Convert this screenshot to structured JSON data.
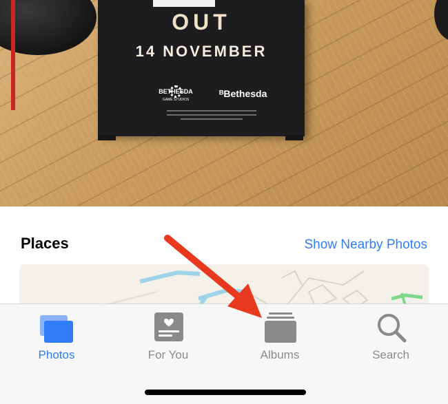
{
  "photo": {
    "sign_headline": "OUT",
    "sign_date": "14 NOVEMBER",
    "logo_studio_line1": "BETHESDA",
    "logo_studio_line2": "GAME STUDIOS",
    "logo_publisher": "ᴮBethesda"
  },
  "places": {
    "title": "Places",
    "link": "Show Nearby Photos"
  },
  "tabbar": {
    "tabs": [
      {
        "label": "Photos",
        "icon": "photos-icon",
        "active": true
      },
      {
        "label": "For You",
        "icon": "for-you-icon",
        "active": false
      },
      {
        "label": "Albums",
        "icon": "albums-icon",
        "active": false
      },
      {
        "label": "Search",
        "icon": "search-icon",
        "active": false
      }
    ]
  },
  "colors": {
    "accent": "#2f7cf6",
    "inactive": "#8a8a8a",
    "annotation_arrow": "#e8391f"
  }
}
